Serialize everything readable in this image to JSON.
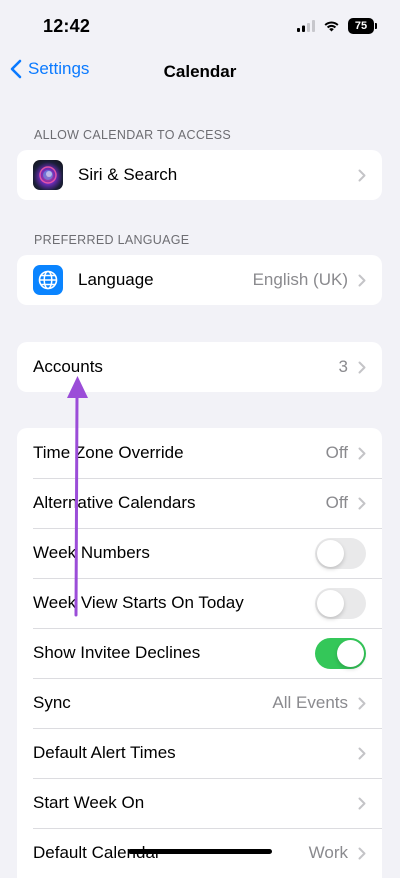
{
  "status": {
    "time": "12:42",
    "battery": "75"
  },
  "nav": {
    "back_label": "Settings",
    "title": "Calendar"
  },
  "sections": {
    "allow_access": {
      "header": "ALLOW CALENDAR TO ACCESS",
      "rows": [
        {
          "label": "Siri & Search",
          "icon": "siri-icon"
        }
      ]
    },
    "preferred_language": {
      "header": "PREFERRED LANGUAGE",
      "rows": [
        {
          "label": "Language",
          "value": "English (UK)",
          "icon": "globe-icon"
        }
      ]
    },
    "accounts": {
      "rows": [
        {
          "label": "Accounts",
          "value": "3"
        }
      ]
    },
    "settings": {
      "rows": [
        {
          "label": "Time Zone Override",
          "value": "Off"
        },
        {
          "label": "Alternative Calendars",
          "value": "Off"
        },
        {
          "label": "Week Numbers",
          "toggle": false
        },
        {
          "label": "Week View Starts On Today",
          "toggle": false
        },
        {
          "label": "Show Invitee Declines",
          "toggle": true
        },
        {
          "label": "Sync",
          "value": "All Events"
        },
        {
          "label": "Default Alert Times"
        },
        {
          "label": "Start Week On"
        },
        {
          "label": "Default Calendar",
          "value": "Work"
        }
      ]
    }
  },
  "annotation": {
    "arrow_color": "#9b4dd8",
    "points_to": "Accounts"
  },
  "colors": {
    "accent": "#0a7aff",
    "toggle_on": "#34c759",
    "background": "#f2f2f7"
  }
}
